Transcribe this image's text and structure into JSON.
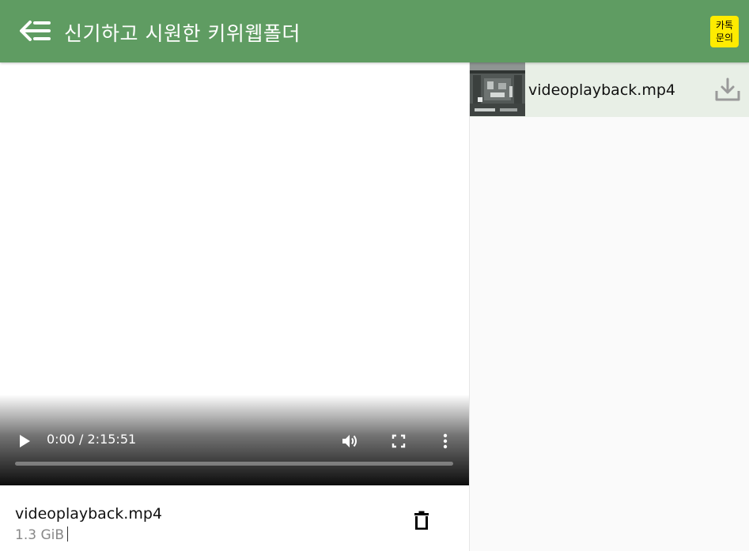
{
  "header": {
    "title": "신기하고 시원한 키위웹폴더",
    "kakao_line1": "카톡",
    "kakao_line2": "문의",
    "colors": {
      "bar": "#5f9c62",
      "kakao": "#ffeb00"
    },
    "icons": {
      "back": "arrow-left-lines-icon"
    }
  },
  "player": {
    "time": "0:00 / 2:15:51",
    "progress_fraction": 0,
    "icons": {
      "play": "play-icon",
      "volume": "volume-icon",
      "fullscreen": "fullscreen-icon",
      "more": "more-vertical-icon"
    }
  },
  "file": {
    "name": "videoplayback.mp4",
    "size": "1.3 GiB",
    "icons": {
      "delete": "trash-icon"
    }
  },
  "sidebar": {
    "items": [
      {
        "name": "videoplayback.mp4",
        "icon": "download-icon"
      }
    ],
    "colors": {
      "selected_bg": "#e8efe6"
    }
  }
}
